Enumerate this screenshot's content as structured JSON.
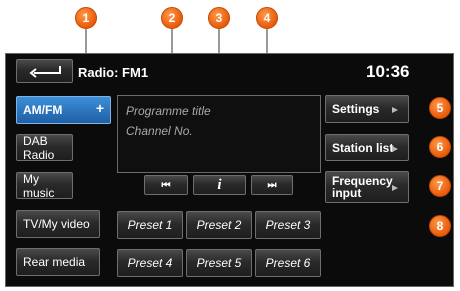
{
  "header": {
    "title": "Radio: FM1",
    "time": "10:36"
  },
  "display": {
    "line1": "Programme title",
    "line2": "Channel No."
  },
  "sidebar": [
    {
      "label": "AM/FM",
      "active": true
    },
    {
      "label": "DAB Radio"
    },
    {
      "label": "My music"
    },
    {
      "label": "TV/My video"
    },
    {
      "label": "Rear media"
    }
  ],
  "controls": {
    "prev": "⏮",
    "info": "i",
    "next": "⏭"
  },
  "right_buttons": [
    {
      "label": "Settings"
    },
    {
      "label": "Station list"
    },
    {
      "label": "Frequency input"
    }
  ],
  "presets": [
    "Preset 1",
    "Preset 2",
    "Preset 3",
    "Preset 4",
    "Preset 5",
    "Preset 6"
  ],
  "callouts": [
    "1",
    "2",
    "3",
    "4",
    "5",
    "6",
    "7",
    "8"
  ],
  "colors": {
    "accent": "#2a78c8",
    "callout": "#f07020",
    "screen": "#0b0b0b"
  }
}
